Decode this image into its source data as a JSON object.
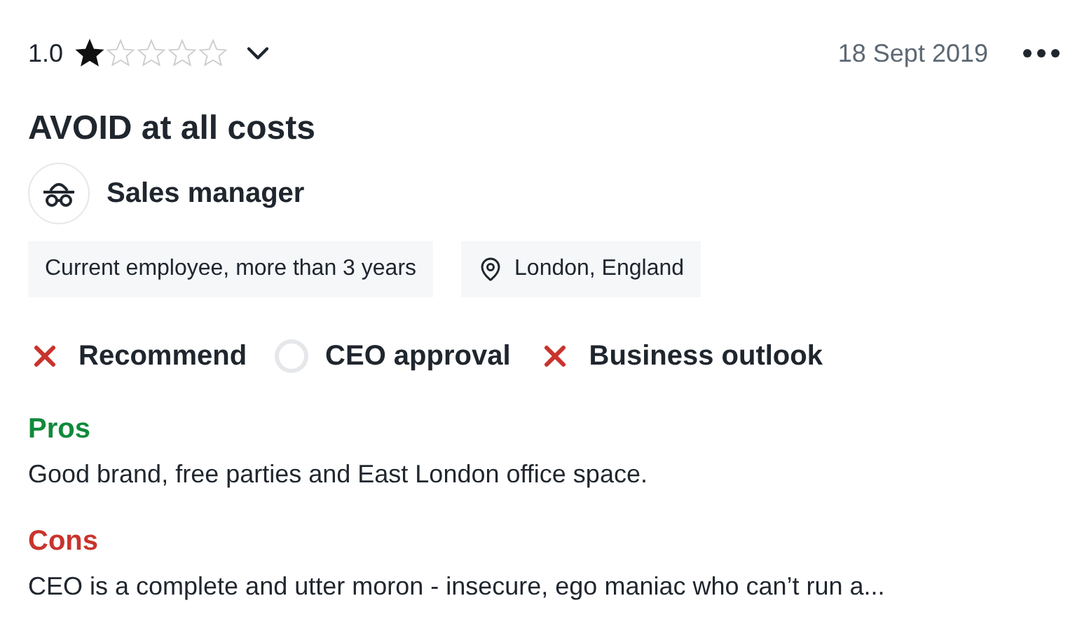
{
  "review": {
    "rating": "1.0",
    "stars": 1,
    "date": "18 Sept 2019",
    "title": "AVOID at all costs",
    "job_title": "Sales manager",
    "tags": [
      {
        "kind": "plain",
        "label": "Current employee, more than 3 years"
      },
      {
        "kind": "location",
        "label": "London, England"
      }
    ],
    "ratings": [
      {
        "label": "Recommend",
        "kind": "negative"
      },
      {
        "label": "CEO approval",
        "kind": "neutral"
      },
      {
        "label": "Business outlook",
        "kind": "negative"
      }
    ],
    "pros": {
      "heading": "Pros",
      "text": "Good brand, free parties and East London office space."
    },
    "cons": {
      "heading": "Cons",
      "text": "CEO is a complete and utter moron - insecure, ego maniac who can’t run a..."
    }
  }
}
